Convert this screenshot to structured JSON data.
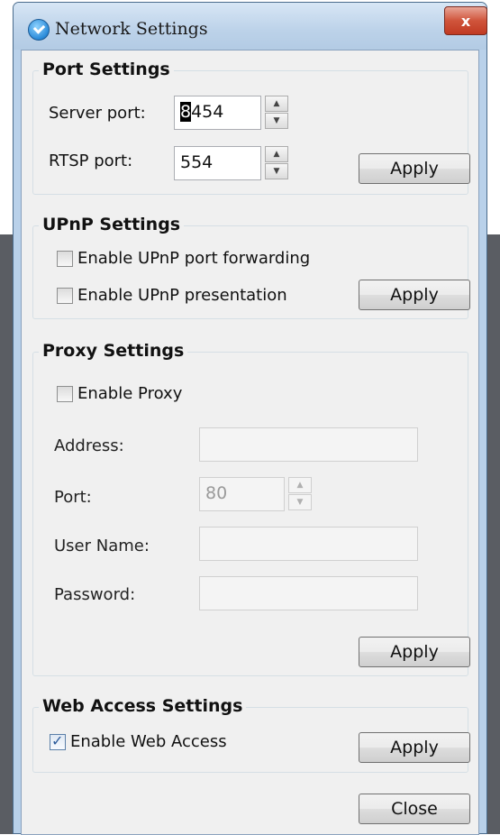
{
  "window": {
    "title": "Network Settings",
    "close_glyph": "x"
  },
  "port_settings": {
    "title": "Port Settings",
    "server_port_label": "Server port:",
    "server_port_value_first": "8",
    "server_port_value_rest": "454",
    "rtsp_port_label": "RTSP port:",
    "rtsp_port_value": "554",
    "apply_label": "Apply"
  },
  "upnp_settings": {
    "title": "UPnP Settings",
    "port_forwarding_label": "Enable UPnP port forwarding",
    "port_forwarding_checked": false,
    "presentation_label": "Enable UPnP presentation",
    "presentation_checked": false,
    "apply_label": "Apply"
  },
  "proxy_settings": {
    "title": "Proxy Settings",
    "enable_label": "Enable Proxy",
    "enable_checked": false,
    "address_label": "Address:",
    "address_value": "",
    "port_label": "Port:",
    "port_value": "80",
    "username_label": "User Name:",
    "username_value": "",
    "password_label": "Password:",
    "password_value": "",
    "apply_label": "Apply"
  },
  "web_access_settings": {
    "title": "Web Access Settings",
    "enable_label": "Enable Web Access",
    "enable_checked": true,
    "apply_label": "Apply"
  },
  "footer": {
    "close_label": "Close"
  }
}
